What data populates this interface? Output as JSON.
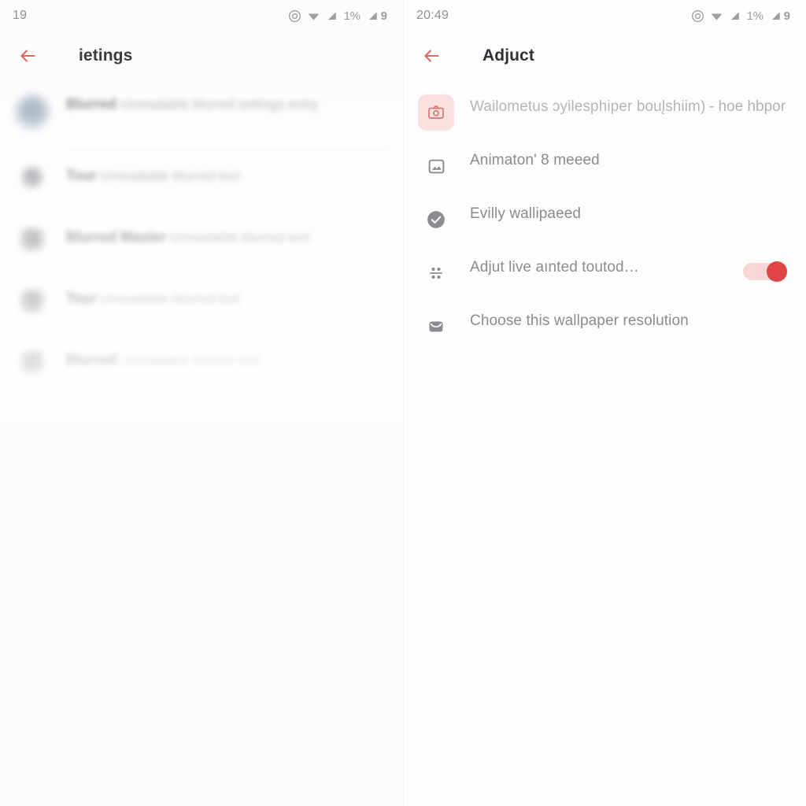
{
  "left_panel": {
    "status_bar": {
      "clock": "19",
      "icons": [
        "target-icon",
        "wifi-icon",
        "signal-icon",
        "signal-alt-icon"
      ],
      "battery_label": "1%",
      "trailing_number": "9"
    },
    "app_bar": {
      "back_icon": "arrow-left-icon",
      "title": "ietings"
    },
    "items": [
      {
        "title": "Blurred",
        "subtitle": "Unreadable blurred settings entry",
        "icon": "avatar-icon"
      },
      {
        "title": "Tour",
        "subtitle": "Unreadable blurred text",
        "icon": "blurred-round-icon"
      },
      {
        "title": "Blurred Master",
        "subtitle": "Unreadable blurred text",
        "icon": "blurred-square-icon"
      },
      {
        "title": "Tour",
        "subtitle": "Unreadable blurred text",
        "icon": "blurred-square-icon"
      },
      {
        "title": "Blurred",
        "subtitle": "Unreadable blurred text",
        "icon": "blurred-square-icon"
      }
    ]
  },
  "right_panel": {
    "status_bar": {
      "clock": "20:49",
      "icons": [
        "target-icon",
        "wifi-icon",
        "signal-icon",
        "signal-alt-icon"
      ],
      "battery_label": "1%",
      "trailing_number": "9"
    },
    "app_bar": {
      "back_icon": "arrow-left-icon",
      "title": "Adjuct"
    },
    "items": [
      {
        "title": "Wailometus ɔyilesphiper boul̨shiim)",
        "subtitle": "- hoe hbpor",
        "icon": "camera-icon",
        "icon_tinted": true,
        "toggle": null
      },
      {
        "title": "Animaton' 8 meeed",
        "subtitle": "",
        "icon": "image-outline-icon",
        "icon_tinted": false,
        "toggle": null
      },
      {
        "title": "Evilly wallipaeed",
        "subtitle": "",
        "icon": "check-circle-icon",
        "icon_tinted": false,
        "toggle": null
      },
      {
        "title": "Adjut live aınted toutod…",
        "subtitle": "",
        "icon": "grid-dots-icon",
        "icon_tinted": false,
        "toggle": "on"
      },
      {
        "title": "Choose this wallpaper resolution",
        "subtitle": "",
        "icon": "mail-icon",
        "icon_tinted": false,
        "toggle": null
      }
    ]
  },
  "colors": {
    "accent_red": "#e04545",
    "back_arrow": "#e2685f",
    "tint_bg": "#fbe0e0",
    "icon_grey": "#8a8c90",
    "text_grey": "#8e9094",
    "page_bg": "#fdfdfe"
  }
}
